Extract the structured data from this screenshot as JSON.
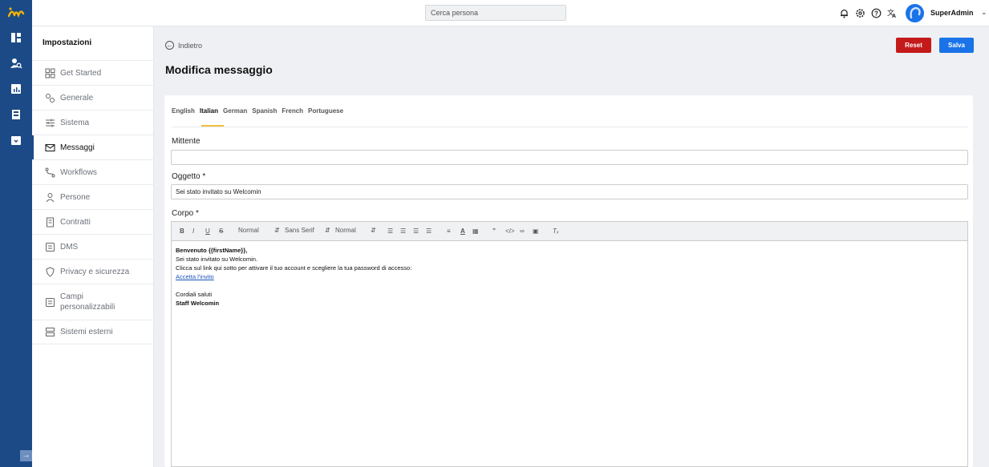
{
  "topbar": {
    "search_placeholder": "Cerca persona",
    "username": "SuperAdmin"
  },
  "sidebar": {
    "title": "Impostazioni",
    "items": [
      {
        "label": "Get Started",
        "icon": "grid-icon"
      },
      {
        "label": "Generale",
        "icon": "gears-icon"
      },
      {
        "label": "Sistema",
        "icon": "sliders-icon"
      },
      {
        "label": "Messaggi",
        "icon": "envelope-icon",
        "active": true
      },
      {
        "label": "Workflows",
        "icon": "workflow-icon"
      },
      {
        "label": "Persone",
        "icon": "person-icon"
      },
      {
        "label": "Contratti",
        "icon": "contract-icon"
      },
      {
        "label": "DMS",
        "icon": "document-icon"
      },
      {
        "label": "Privacy e sicurezza",
        "icon": "shield-icon"
      },
      {
        "label": "Campi personalizzabili",
        "icon": "document-icon"
      },
      {
        "label": "Sistemi esterni",
        "icon": "server-icon"
      }
    ]
  },
  "main": {
    "back_label": "Indietro",
    "title": "Modifica messaggio",
    "reset_label": "Reset",
    "save_label": "Salva",
    "tabs": [
      "English",
      "Italian",
      "German",
      "Spanish",
      "French",
      "Portuguese"
    ],
    "active_tab": "Italian",
    "fields": {
      "sender_label": "Mittente",
      "sender_value": "",
      "subject_label": "Oggetto *",
      "subject_value": "Sei stato invitato su Welcomin",
      "body_label": "Corpo *"
    },
    "toolbar": {
      "heading_select": "Normal",
      "font_select": "Sans Serif",
      "size_select": "Normal"
    },
    "body": {
      "greeting": "Benvenuto {{firstName}},",
      "line1": "Sei stato invitato su Welcomin.",
      "line2": "Clicca sul link qui sotto per attivare il tuo account e scegliere la tua password di accesso:",
      "link": "Accetta l'invito",
      "closing": "Cordiali saluti",
      "signature": "Staff Welcomin"
    }
  },
  "colors": {
    "rail": "#1b4a87",
    "accent": "#1a73e8",
    "danger": "#c41a1a",
    "tab_underline": "#f0c040"
  }
}
